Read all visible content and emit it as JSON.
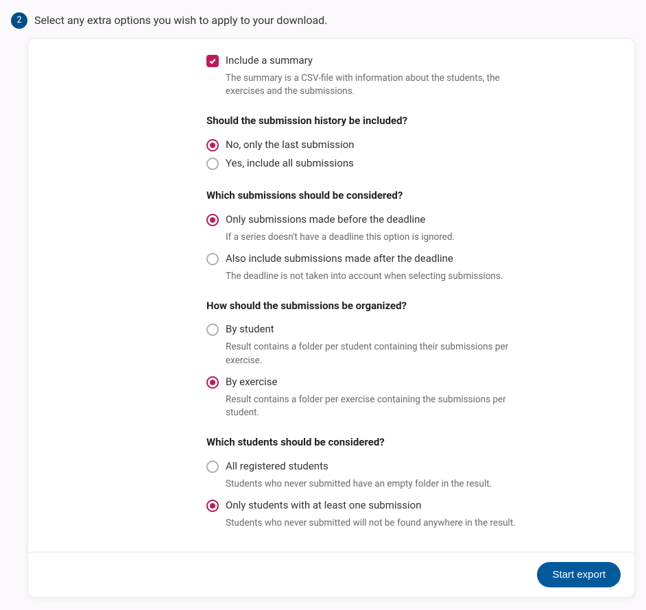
{
  "step": {
    "number": "2",
    "title": "Select any extra options you wish to apply to your download."
  },
  "options": {
    "include_summary": {
      "label": "Include a summary",
      "desc": "The summary is a CSV-file with information about the students, the exercises and the submissions."
    },
    "history": {
      "heading": "Should the submission history be included?",
      "last_only": "No, only the last submission",
      "all": "Yes, include all submissions"
    },
    "considered": {
      "heading": "Which submissions should be considered?",
      "before": {
        "label": "Only submissions made before the deadline",
        "desc": "If a series doesn't have a deadline this option is ignored."
      },
      "after": {
        "label": "Also include submissions made after the deadline",
        "desc": "The deadline is not taken into account when selecting submissions."
      }
    },
    "organized": {
      "heading": "How should the submissions be organized?",
      "by_student": {
        "label": "By student",
        "desc": "Result contains a folder per student containing their submissions per exercise."
      },
      "by_exercise": {
        "label": "By exercise",
        "desc": "Result contains a folder per exercise containing the submissions per student."
      }
    },
    "students": {
      "heading": "Which students should be considered?",
      "all": {
        "label": "All registered students",
        "desc": "Students who never submitted have an empty folder in the result."
      },
      "at_least_one": {
        "label": "Only students with at least one submission",
        "desc": "Students who never submitted will not be found anywhere in the result."
      }
    }
  },
  "footer": {
    "start_export": "Start export"
  }
}
